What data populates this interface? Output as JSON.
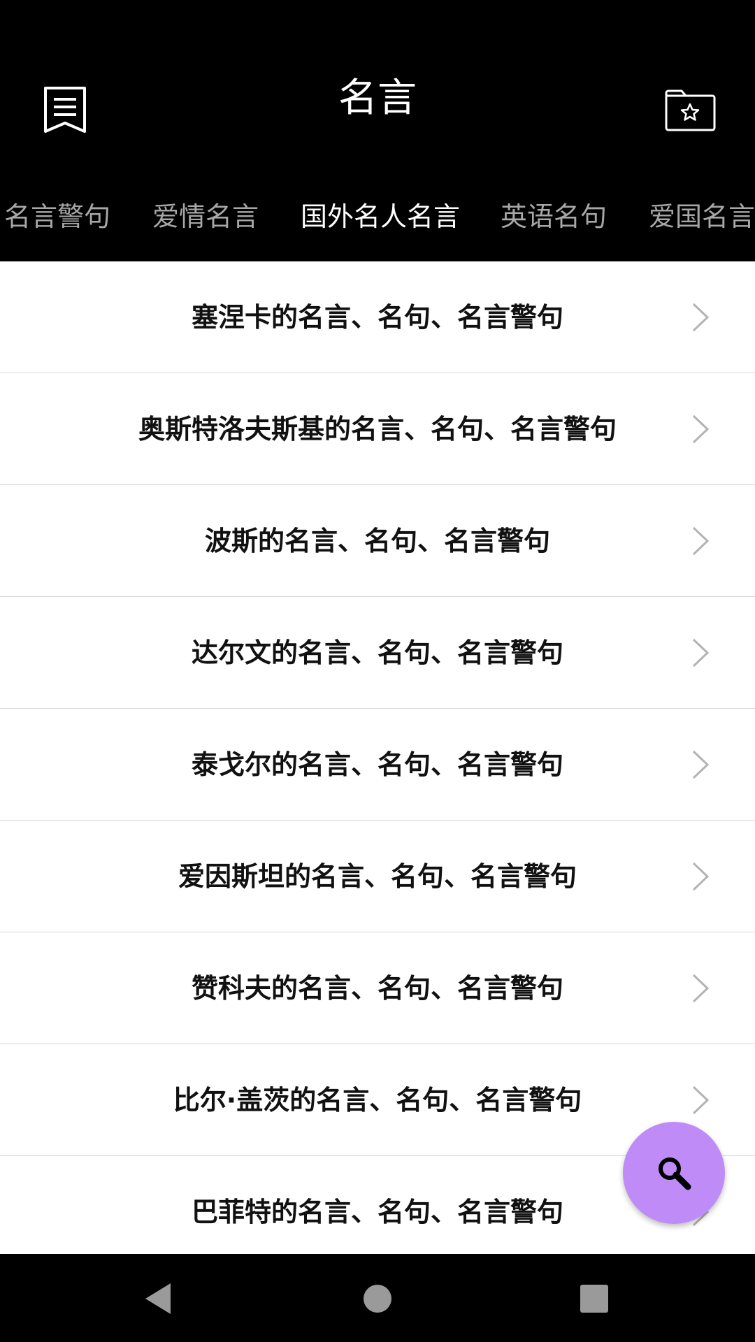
{
  "header": {
    "title": "名言",
    "menu_icon": "list-bookmark-icon",
    "favorites_icon": "star-folder-icon"
  },
  "tabs": [
    {
      "label": "名言警句",
      "active": false
    },
    {
      "label": "爱情名言",
      "active": false
    },
    {
      "label": "国外名人名言",
      "active": true
    },
    {
      "label": "英语名句",
      "active": false
    },
    {
      "label": "爱国名言",
      "active": false
    }
  ],
  "list": [
    {
      "title": "塞涅卡的名言、名句、名言警句"
    },
    {
      "title": "奥斯特洛夫斯基的名言、名句、名言警句"
    },
    {
      "title": "波斯的名言、名句、名言警句"
    },
    {
      "title": "达尔文的名言、名句、名言警句"
    },
    {
      "title": "泰戈尔的名言、名句、名言警句"
    },
    {
      "title": "爱因斯坦的名言、名句、名言警句"
    },
    {
      "title": "赞科夫的名言、名句、名言警句"
    },
    {
      "title": "比尔·盖茨的名言、名句、名言警句"
    },
    {
      "title": "巴菲特的名言、名句、名言警句"
    }
  ],
  "fab": {
    "icon": "search-icon",
    "color": "#bf8bf7"
  },
  "navbar": {
    "back_icon": "back-triangle-icon",
    "home_icon": "home-circle-icon",
    "recent_icon": "recents-square-icon"
  },
  "colors": {
    "header_bg": "#000000",
    "tab_inactive": "#a7a7a7",
    "tab_active": "#ffffff",
    "divider": "#d8d8d8"
  }
}
